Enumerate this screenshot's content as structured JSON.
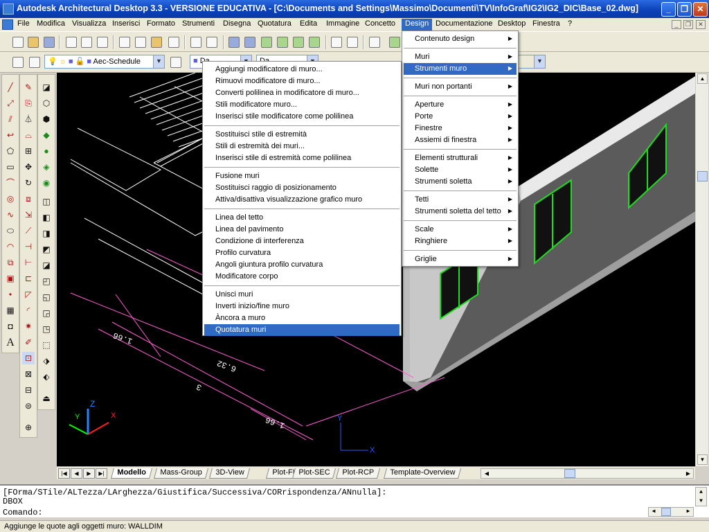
{
  "window": {
    "title": "Autodesk Architectural Desktop 3.3 - VERSIONE EDUCATIVA - [C:\\Documents and Settings\\Massimo\\Documenti\\TV\\InfoGraf\\IG2\\IG2_DIC\\Base_02.dwg]",
    "min_symbol": "_",
    "max_symbol": "❐",
    "close_symbol": "✕"
  },
  "menubar": {
    "items": [
      "File",
      "Modifica",
      "Visualizza",
      "Inserisci",
      "Formato",
      "Strumenti",
      "Disegna",
      "Quotatura",
      "Edita",
      "Immagine",
      "Concetto",
      "Design",
      "Documentazione",
      "Desktop",
      "Finestra",
      "?"
    ],
    "active": "Design"
  },
  "toolbar2": {
    "layer_combo": "Aec-Schedule",
    "color_combo": "Da",
    "linetype_combo": "Da"
  },
  "design_menu": {
    "items": [
      {
        "label": "Contenuto design",
        "submenu": true
      },
      {
        "label": "Muri",
        "submenu": true
      },
      {
        "label": "Strumenti muro",
        "submenu": true,
        "selected": true
      },
      {
        "label": "Muri non portanti",
        "submenu": true
      },
      {
        "label": "Aperture",
        "submenu": true
      },
      {
        "label": "Porte",
        "submenu": true
      },
      {
        "label": "Finestre",
        "submenu": true
      },
      {
        "label": "Assiemi di finestra",
        "submenu": true
      },
      {
        "label": "Elementi strutturali",
        "submenu": true
      },
      {
        "label": "Solette",
        "submenu": true
      },
      {
        "label": "Strumenti soletta",
        "submenu": true
      },
      {
        "label": "Tetti",
        "submenu": true
      },
      {
        "label": "Strumenti soletta del tetto",
        "submenu": true
      },
      {
        "label": "Scale",
        "submenu": true
      },
      {
        "label": "Ringhiere",
        "submenu": true
      },
      {
        "label": "Griglie",
        "submenu": true
      }
    ]
  },
  "wall_tools_menu": {
    "items": [
      "Aggiungi modificatore di muro...",
      "Rimuovi modificatore di muro...",
      "Converti polilinea in modificatore di muro...",
      "Stili modificatore muro...",
      "Inserisci stile modificatore come polilinea",
      "Sostituisci stile di estremità",
      "Stili di estremità dei muri...",
      "Inserisci stile di estremità come polilinea",
      "Fusione muri",
      "Sostituisci raggio di posizionamento",
      "Attiva/disattiva visualizzazione grafico muro",
      "Linea del tetto",
      "Linea del pavimento",
      "Condizione di interferenza",
      "Profilo curvatura",
      "Angoli giuntura profilo curvatura",
      "Modificatore corpo",
      "Unisci muri",
      "Inverti inizio/fine muro",
      "Àncora a muro",
      "Quotatura muri"
    ],
    "selected": "Quotatura muri"
  },
  "drawing": {
    "dimensions": [
      "1.66",
      "6.32",
      "3",
      "1.66"
    ],
    "ucs": {
      "x": "X",
      "y": "Y",
      "z": "Z"
    },
    "colors": {
      "background": "#000000",
      "dimension": "#ff5fd2",
      "window_frame": "#1edc1e",
      "wall": "#5b5b5b"
    }
  },
  "layout_tabs": {
    "items": [
      "Modello",
      "Mass-Group",
      "3D-View",
      "Plot-FLR",
      "Plot-SEC",
      "Plot-RCP",
      "Template-Overview"
    ],
    "active": "Modello"
  },
  "command": {
    "line1": "[FOrma/STile/ALTezza/LArghezza/Giustifica/Successiva/CORrispondenza/ANnulla]:",
    "line2": "DBOX",
    "prompt": "Comando:"
  },
  "status": {
    "text": "Aggiunge le quote agli oggetti muro: WALLDIM"
  },
  "colors": {
    "menu_highlight": "#316ac5",
    "titlebar": "#0a3fb8"
  }
}
